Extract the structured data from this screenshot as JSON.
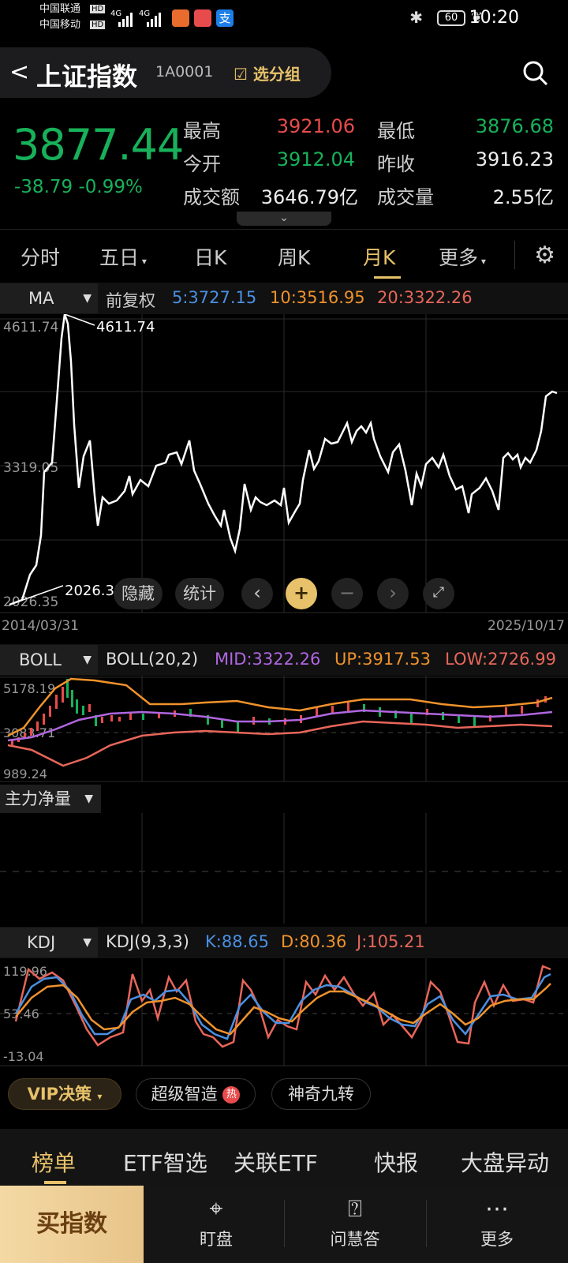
{
  "status": {
    "carrier1": "中国联通",
    "carrier2": "中国移动",
    "hd": "HD",
    "net": "4G",
    "battery": "60",
    "time": "10:20"
  },
  "header": {
    "back": "<",
    "title": "上证指数",
    "code": "1A0001",
    "group": "选分组",
    "group_icon": "check-square-icon",
    "search_icon": "search-icon"
  },
  "quote": {
    "price": "3877.44",
    "change": "-38.79",
    "change_pct": "-0.99%",
    "high_label": "最高",
    "high": "3921.06",
    "low_label": "最低",
    "low": "3876.68",
    "open_label": "今开",
    "open": "3912.04",
    "prev_label": "昨收",
    "prev": "3916.23",
    "amount_label": "成交额",
    "amount": "3646.79亿",
    "volume_label": "成交量",
    "volume": "2.55亿",
    "colors": {
      "up": "#e84b4b",
      "down": "#18b15a"
    }
  },
  "period_tabs": [
    "分时",
    "五日",
    "日K",
    "周K",
    "月K",
    "更多"
  ],
  "period_active": "月K",
  "ma_bar": {
    "selector": "MA",
    "adjust": "前复权",
    "ma5": "5:3727.15",
    "ma10": "10:3516.95",
    "ma20": "20:3322.26",
    "colors": {
      "ma5": "#4a90e2",
      "ma10": "#f0922b",
      "ma20": "#e8665a"
    }
  },
  "main_chart": {
    "y_top": "4611.74",
    "y_mid": "3319.05",
    "y_bottom": "2026.35",
    "max_label": "4611.74",
    "min_label": "2026.35",
    "date_start": "2014/03/31",
    "date_end": "2025/10/17"
  },
  "chart_tools": {
    "hide": "隐藏",
    "stats": "统计",
    "plus": "+",
    "minus": "−",
    "prev": "‹",
    "next": "›",
    "expand": "expand-icon"
  },
  "boll": {
    "selector": "BOLL",
    "name": "BOLL(20,2)",
    "mid": "MID:3322.26",
    "up": "UP:3917.53",
    "low": "LOW:2726.99",
    "y_top": "5178.19",
    "y_mid": "3083.71",
    "y_bottom": "989.24"
  },
  "main_force": {
    "selector": "主力净量"
  },
  "kdj": {
    "selector": "KDJ",
    "name": "KDJ(9,3,3)",
    "k": "K:88.65",
    "d": "D:80.36",
    "j": "J:105.21",
    "y_top": "119.96",
    "y_mid": "53.46",
    "y_bottom": "-13.04"
  },
  "chips": {
    "vip": "VIP决策",
    "super": "超级智造",
    "hot": "热",
    "nine": "神奇九转"
  },
  "bottom_tabs": [
    "榜单",
    "ETF智选",
    "关联ETF",
    "快报",
    "大盘异动"
  ],
  "nav": {
    "buy": "买指数",
    "watch": "盯盘",
    "ask": "问慧答",
    "more": "更多"
  }
}
